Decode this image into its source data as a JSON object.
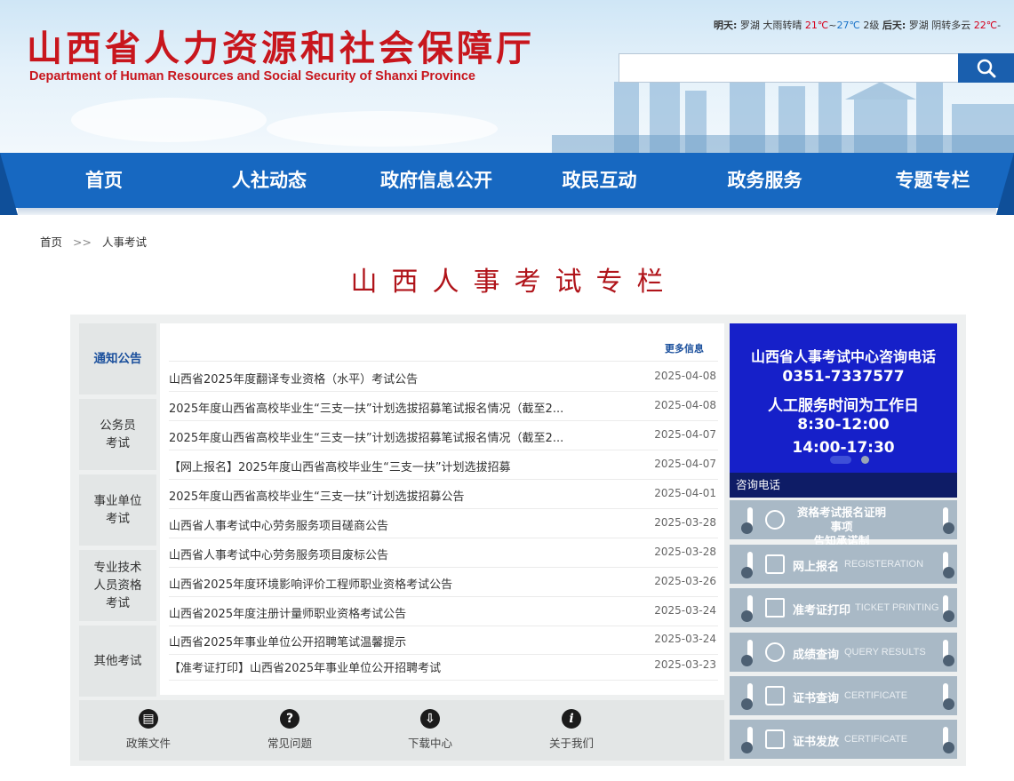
{
  "header": {
    "title_cn": "山西省人力资源和社会保障厅",
    "title_en": "Department of Human Resources and Social Security of Shanxi Province",
    "weather": {
      "today_label": "明天:",
      "today_place": "罗湖",
      "today_desc": "大雨转晴",
      "today_low": "21℃",
      "tilde": "~",
      "today_high": "27℃",
      "today_wind": "2级",
      "next_label": "后天:",
      "next_place": "罗湖",
      "next_desc": "阴转多云",
      "next_temp": "22℃",
      "trail": "-"
    },
    "search": {
      "placeholder": ""
    }
  },
  "nav": {
    "items": [
      "首页",
      "人社动态",
      "政府信息公开",
      "政民互动",
      "政务服务",
      "专题专栏"
    ]
  },
  "breadcrumb": {
    "home": "首页",
    "sep": ">>",
    "current": "人事考试"
  },
  "page_title": "山西人事考试专栏",
  "tabs": [
    "通知公告",
    "公务员\n考试",
    "事业单位\n考试",
    "专业技术\n人员资格\n考试",
    "其他考试"
  ],
  "news": {
    "more": "更多信息",
    "items": [
      {
        "title": "山西省2025年度翻译专业资格（水平）考试公告",
        "date": "2025-04-08"
      },
      {
        "title": "2025年度山西省高校毕业生“三支一扶”计划选拔招募笔试报名情况（截至2...",
        "date": "2025-04-08"
      },
      {
        "title": "2025年度山西省高校毕业生“三支一扶”计划选拔招募笔试报名情况（截至2...",
        "date": "2025-04-07"
      },
      {
        "title": "【网上报名】2025年度山西省高校毕业生“三支一扶”计划选拔招募",
        "date": "2025-04-07"
      },
      {
        "title": "2025年度山西省高校毕业生“三支一扶”计划选拔招募公告",
        "date": "2025-04-01"
      },
      {
        "title": "山西省人事考试中心劳务服务项目磋商公告",
        "date": "2025-03-28"
      },
      {
        "title": "山西省人事考试中心劳务服务项目废标公告",
        "date": "2025-03-28"
      },
      {
        "title": "山西省2025年度环境影响评价工程师职业资格考试公告",
        "date": "2025-03-26"
      },
      {
        "title": "山西省2025年度注册计量师职业资格考试公告",
        "date": "2025-03-24"
      },
      {
        "title": "山西省2025年事业单位公开招聘笔试温馨提示",
        "date": "2025-03-24"
      },
      {
        "title": "【准考证打印】山西省2025年事业单位公开招聘考试",
        "date": "2025-03-23"
      }
    ]
  },
  "quick_links": [
    {
      "label": "政策文件",
      "icon": "document-icon",
      "glyph": "▤"
    },
    {
      "label": "常见问题",
      "icon": "question-icon",
      "glyph": "?"
    },
    {
      "label": "下载中心",
      "icon": "download-cloud-icon",
      "glyph": "⇩"
    },
    {
      "label": "关于我们",
      "icon": "info-icon",
      "glyph": "i"
    }
  ],
  "banner": {
    "line1": "山西省人事考试中心咨询电话",
    "line2": "0351-7337577",
    "line3": "人工服务时间为工作日",
    "line4": "8:30-12:00",
    "line5": "14:00-17:30",
    "caption": "咨询电话"
  },
  "services": [
    {
      "cn": "资格考试报名证明事项\n告知承诺制",
      "en": "",
      "icon": "handshake-icon"
    },
    {
      "cn": "网上报名",
      "en": "REGISTERATION",
      "icon": "edit-form-icon"
    },
    {
      "cn": "准考证打印",
      "en": "TICKET PRINTING",
      "icon": "printer-icon"
    },
    {
      "cn": "成绩查询",
      "en": "QUERY RESULTS",
      "icon": "magnifier-icon"
    },
    {
      "cn": "证书查询",
      "en": "CERTIFICATE",
      "icon": "certificate-search-icon"
    },
    {
      "cn": "证书发放",
      "en": "CERTIFICATE",
      "icon": "certificate-issue-icon"
    }
  ],
  "colors": {
    "brand_red": "#c8161d",
    "nav_blue": "#1768c1",
    "banner_blue": "#1620c9"
  }
}
